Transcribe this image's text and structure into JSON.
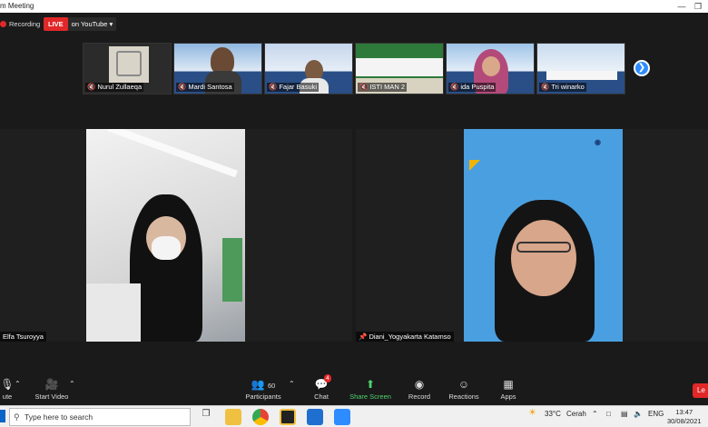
{
  "window": {
    "title": "m Meeting"
  },
  "recording": {
    "label": "Recording"
  },
  "live": {
    "badge": "LIVE",
    "platform": "on YouTube ▾"
  },
  "participants_strip": [
    {
      "name": "Nurul Zullaeqa",
      "bg": "#d9d4c8"
    },
    {
      "name": "Mardi Santosa",
      "bg": "#8fb7e0"
    },
    {
      "name": "Fajar Basuki",
      "bg": "#c5d6ec"
    },
    {
      "name": "ISTI MAN 2",
      "bg": "#2e7a3a"
    },
    {
      "name": "ida Puspita",
      "bg": "#9ec4e8"
    },
    {
      "name": "Tri winarko",
      "bg": "#c9dcef"
    }
  ],
  "tiles": {
    "left": {
      "name": "Elfa Tsuroyya"
    },
    "right": {
      "name": "Diani_Yogyakarta Katamso"
    }
  },
  "toolbar": {
    "mute": "ute",
    "start_video": "Start Video",
    "participants": "Participants",
    "participants_count": "60",
    "chat": "Chat",
    "chat_badge": "4",
    "share_screen": "Share Screen",
    "record": "Record",
    "reactions": "Reactions",
    "apps": "Apps",
    "leave": "Le"
  },
  "taskbar": {
    "search_placeholder": "Type here to search",
    "temperature": "33°C",
    "weather": "Cerah",
    "language": "ENG",
    "time": "13:47",
    "date": "30/08/2021"
  },
  "colors": {
    "live_red": "#e02828",
    "zoom_blue": "#2d8cff",
    "share_green": "#4fd36e"
  }
}
